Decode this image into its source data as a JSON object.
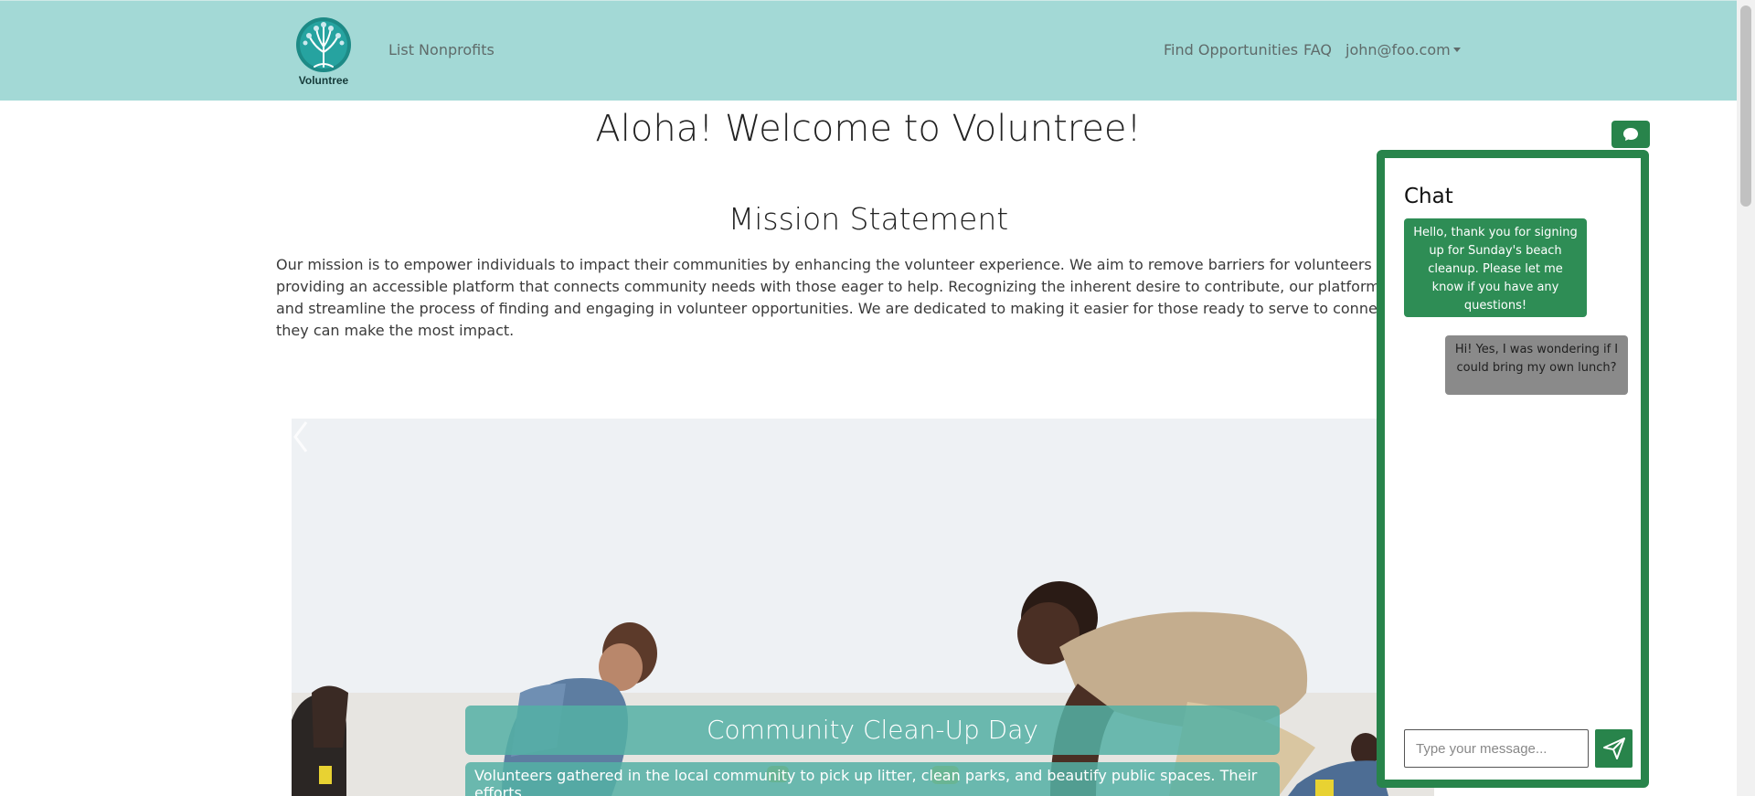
{
  "app": {
    "title": "Voluntree"
  },
  "navbar": {
    "brand": {
      "name": "Voluntree",
      "icon": "tree-logo-icon"
    },
    "left_link": "List Nonprofits",
    "right_links": {
      "find": "Find Opportunities",
      "faq": "FAQ",
      "user": "john@foo.com"
    }
  },
  "main": {
    "title": "Aloha! Welcome to Voluntree!",
    "mission": {
      "heading": "Mission Statement",
      "lines": [
        "Our mission is to empower individuals to impact their communities by enhancing the volunteer experience. We aim to remove barriers for volunteers and philanthrop",
        "providing an accessible platform that connects community needs with those eager to help. Recognizing the inherent desire to contribute, our platform is designed t",
        "and streamline the process of finding and engaging in volunteer opportunities. We are dedicated to making it easier for those ready to serve to connect with the ave",
        "they can make the most impact."
      ]
    }
  },
  "carousel": {
    "caption_title": "Community Clean-Up Day",
    "caption_text": "Volunteers gathered in the local community to pick up litter, clean parks, and beautify public spaces. Their efforts",
    "prev_icon": "chevron-left-icon"
  },
  "chat": {
    "toggle_icon": "chat-bubble-icon",
    "header": "Chat",
    "messages": [
      {
        "from": "org",
        "text": "Hello, thank you for signing up for Sunday's beach cleanup. Please let me know if you have any questions!"
      },
      {
        "from": "user",
        "text": "Hi! Yes, I was wondering if I could bring my own lunch?"
      }
    ],
    "input_placeholder": "Type your message...",
    "send_icon": "send-icon"
  },
  "colors": {
    "navbar_bg": "#a3d9d6",
    "chat_accent": "#28844b",
    "caption_bg": "#54b0a5",
    "message_out_bg": "#8a8a8a"
  }
}
